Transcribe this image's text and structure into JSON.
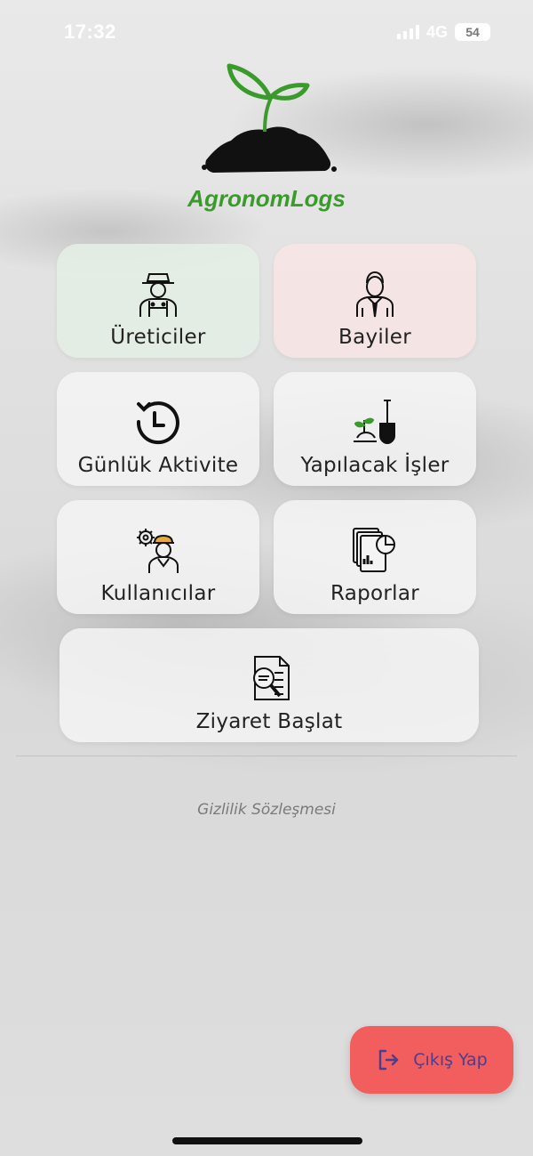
{
  "status_bar": {
    "time": "17:32",
    "network": "4G",
    "battery": "54"
  },
  "app": {
    "logo_text": "AgronomLogs",
    "brand_color": "#3a9a2b"
  },
  "menu": [
    {
      "label": "Üreticiler",
      "icon": "farmer-icon"
    },
    {
      "label": "Bayiler",
      "icon": "businessman-icon"
    },
    {
      "label": "Günlük Aktivite",
      "icon": "history-clock-icon"
    },
    {
      "label": "Yapılacak İşler",
      "icon": "gardening-shovel-icon"
    },
    {
      "label": "Kullanıcılar",
      "icon": "engineer-gear-icon"
    },
    {
      "label": "Raporlar",
      "icon": "report-documents-icon"
    },
    {
      "label": "Ziyaret Başlat",
      "icon": "document-search-icon"
    }
  ],
  "footer": {
    "privacy_link": "Gizlilik Sözleşmesi"
  },
  "logout": {
    "label": "Çıkış Yap",
    "icon": "logout-icon",
    "color": "#f25d5e"
  }
}
